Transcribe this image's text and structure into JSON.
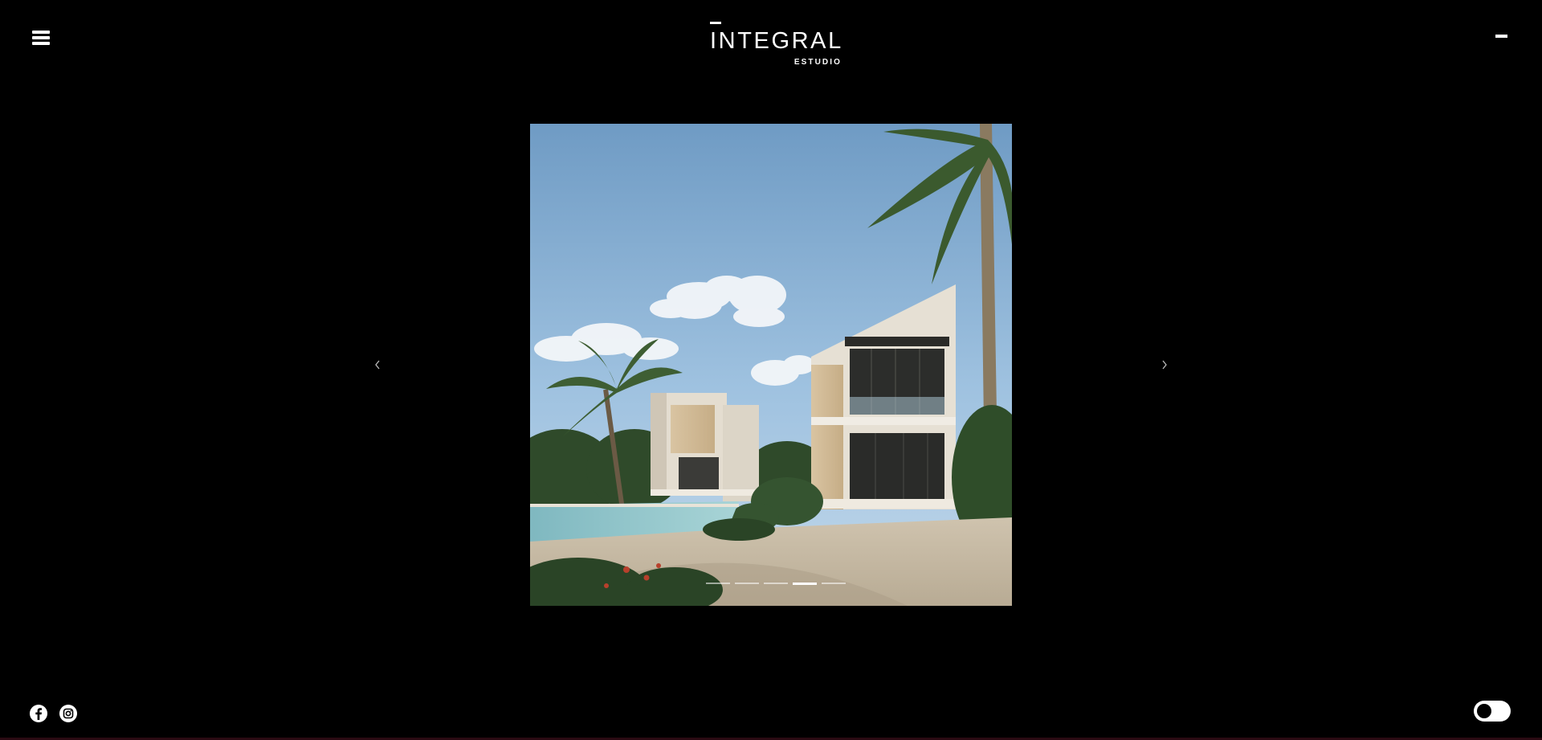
{
  "header": {
    "menu_icon": "hamburger-icon",
    "logo": {
      "main": "INTEGRAL",
      "sub": "ESTUDIO"
    },
    "collapse_icon": "minus-icon"
  },
  "gallery": {
    "image_alt": "Render of modern beachfront villas with palm trees and pool",
    "prev_icon": "chevron-left-icon",
    "next_icon": "chevron-right-icon",
    "slide_count": 5,
    "active_slide": 4
  },
  "footer": {
    "social": [
      {
        "name": "facebook",
        "icon": "facebook-icon"
      },
      {
        "name": "instagram",
        "icon": "instagram-icon"
      }
    ],
    "theme_toggle": {
      "icon": "toggle-icon",
      "state": "dark"
    }
  },
  "colors": {
    "background": "#000000",
    "foreground": "#ffffff",
    "bottom_accent": "#2a0a12"
  }
}
